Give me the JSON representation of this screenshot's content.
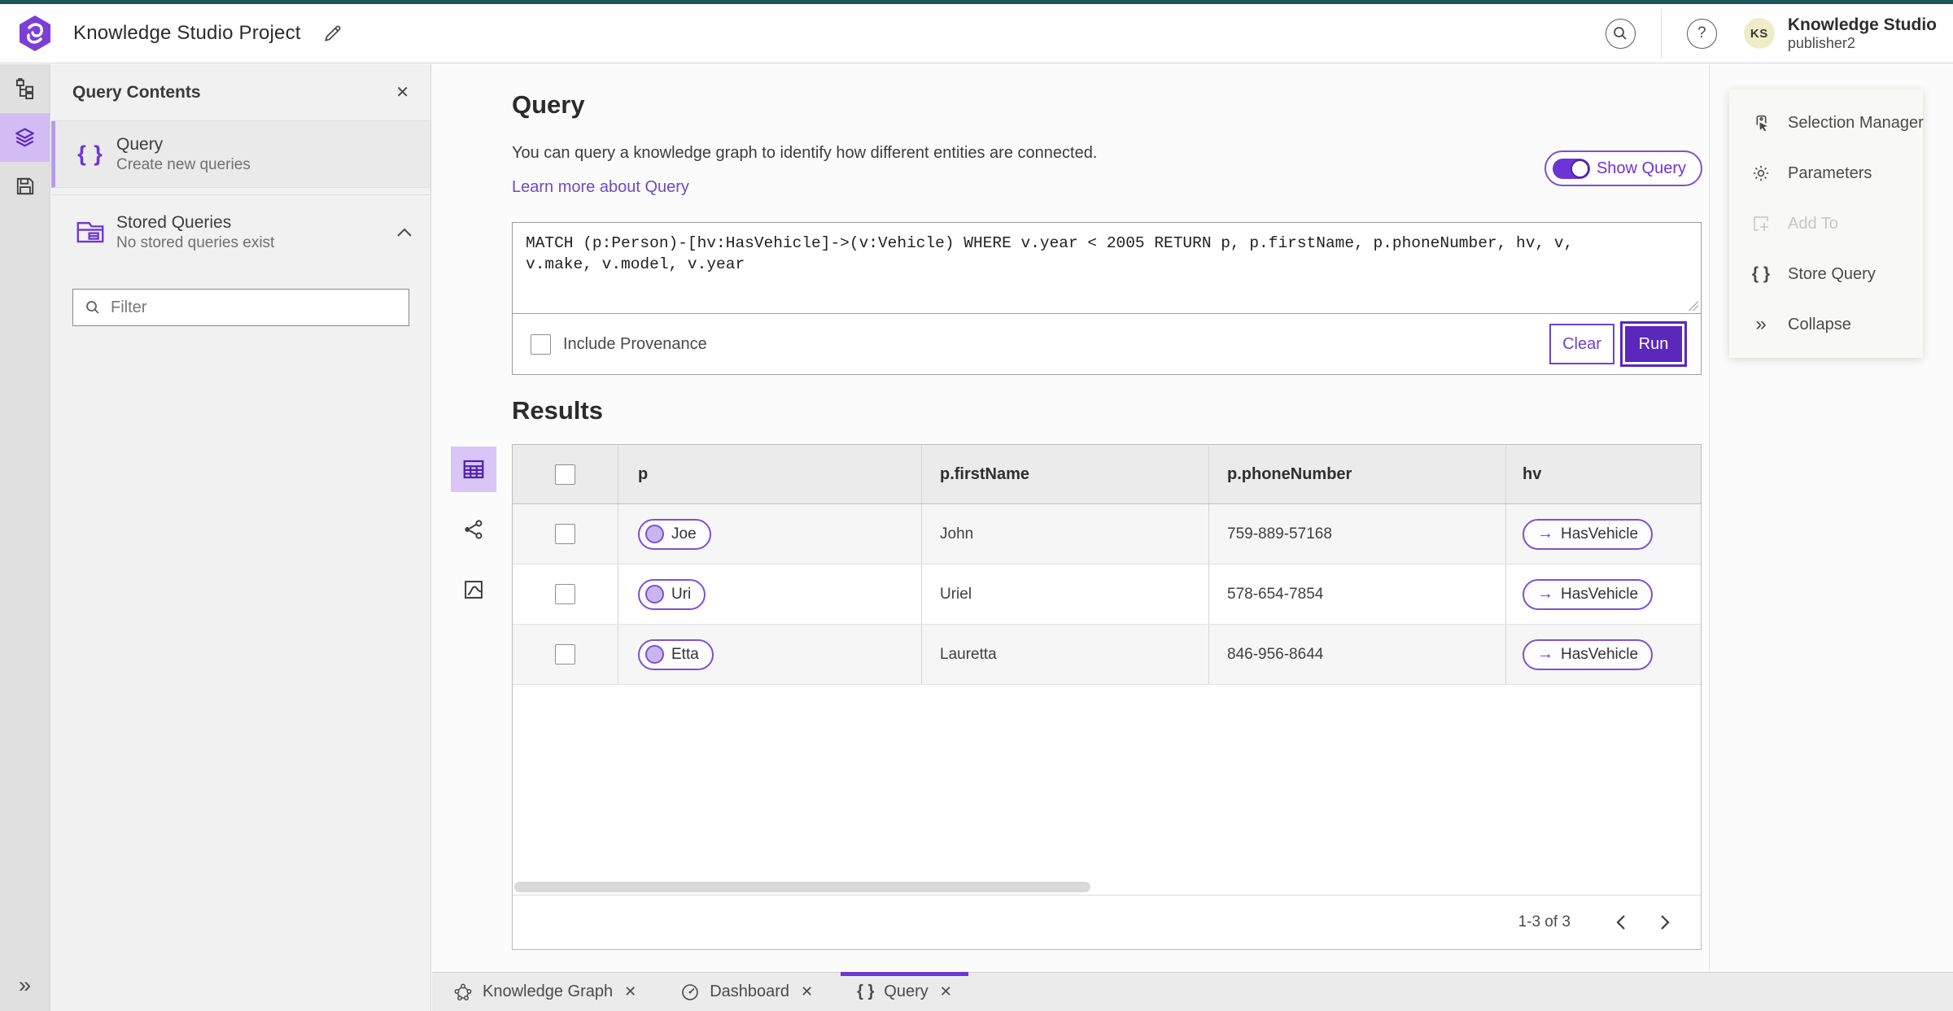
{
  "colors": {
    "top_strip_teal": "#1a575d",
    "accent_purple": "#6d35d6",
    "accent_purple_dark": "#5b27bd",
    "selection_lavender": "#d3bcf4",
    "link_purple": "#6a4cc6",
    "pill_border_purple": "#7b52d3"
  },
  "icons": {
    "close": "✕",
    "braces": "{ }",
    "double_chevron_right": "»",
    "relation_arrow": "→",
    "help": "?"
  },
  "header": {
    "app_title": "Knowledge Studio Project",
    "user_name": "Knowledge Studio",
    "user_role": "publisher2",
    "avatar_initials": "KS"
  },
  "left_panel": {
    "title": "Query Contents",
    "query_item": {
      "label": "Query",
      "description": "Create new queries"
    },
    "stored_item": {
      "label": "Stored Queries",
      "description": "No stored queries exist"
    },
    "filter_placeholder": "Filter"
  },
  "query_section": {
    "title": "Query",
    "description": "You can query a knowledge graph to identify how different entities are connected.",
    "link_label": "Learn more about Query",
    "show_query_label": "Show Query",
    "query_text": "MATCH (p:Person)-[hv:HasVehicle]->(v:Vehicle) WHERE v.year < 2005 RETURN p, p.firstName, p.phoneNumber, hv, v, v.make, v.model, v.year",
    "include_provenance_label": "Include Provenance",
    "clear_label": "Clear",
    "run_label": "Run"
  },
  "results": {
    "title": "Results",
    "columns": [
      "p",
      "p.firstName",
      "p.phoneNumber",
      "hv"
    ],
    "rows": [
      {
        "p": "Joe",
        "firstName": "John",
        "phoneNumber": "759-889-57168",
        "hv": "HasVehicle"
      },
      {
        "p": "Uri",
        "firstName": "Uriel",
        "phoneNumber": "578-654-7854",
        "hv": "HasVehicle"
      },
      {
        "p": "Etta",
        "firstName": "Lauretta",
        "phoneNumber": "846-956-8644",
        "hv": "HasVehicle"
      }
    ],
    "pagination_label": "1-3 of 3"
  },
  "right_panel": {
    "items": [
      {
        "label": "Selection Manager"
      },
      {
        "label": "Parameters"
      },
      {
        "label": "Add To"
      },
      {
        "label": "Store Query"
      },
      {
        "label": "Collapse"
      }
    ]
  },
  "bottom_tabs": [
    {
      "label": "Knowledge Graph"
    },
    {
      "label": "Dashboard"
    },
    {
      "label": "Query"
    }
  ]
}
